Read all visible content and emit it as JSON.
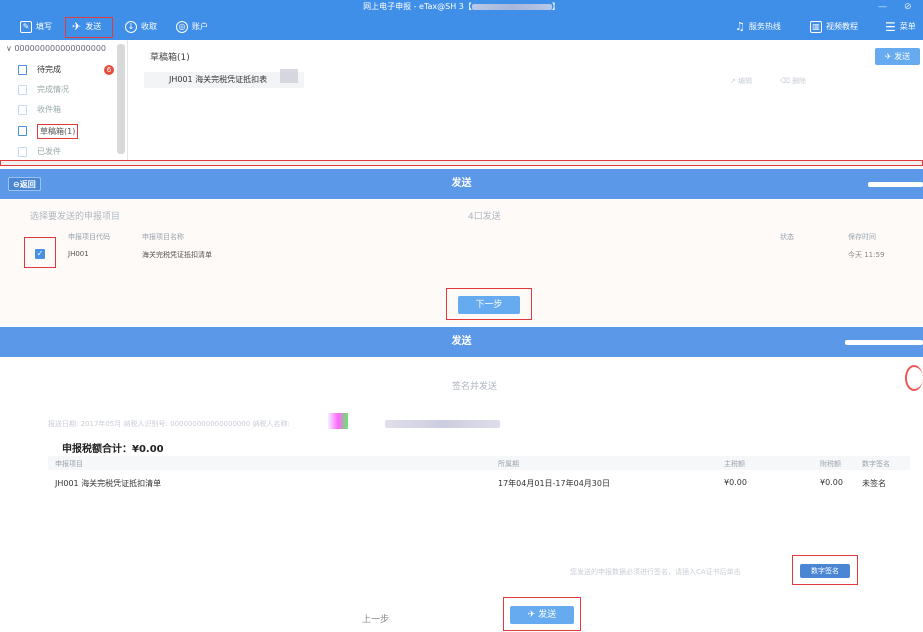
{
  "window": {
    "title": "网上电子申报 - eTax@SH 3【",
    "title_suffix": "】",
    "controls": [
      "—",
      "⊘"
    ]
  },
  "toolbar": {
    "items": [
      {
        "label": "填写",
        "icon": "edit-icon"
      },
      {
        "label": "发送",
        "icon": "send-icon"
      },
      {
        "label": "收取",
        "icon": "download-icon"
      },
      {
        "label": "账户",
        "icon": "account-icon"
      }
    ],
    "right": [
      {
        "label": "服务热线",
        "icon": "headset-icon"
      },
      {
        "label": "视频教程",
        "icon": "video-icon"
      },
      {
        "label": "菜单",
        "icon": "menu-icon"
      }
    ]
  },
  "sidebar": {
    "header": "∨ 000000000000000000",
    "items": [
      {
        "label": "待完成",
        "badge": "6"
      },
      {
        "label": "完成情况",
        "badge": ""
      },
      {
        "label": "收件箱",
        "badge": ""
      },
      {
        "label": "草稿箱(1)",
        "badge": ""
      },
      {
        "label": "已发件",
        "badge": ""
      }
    ]
  },
  "draftbox": {
    "title": "草稿箱(1)",
    "send_button": "发送",
    "row_text": "JH001  海关完税凭证抵扣表",
    "row_actions": [
      "编辑",
      "删除"
    ]
  },
  "send_step1": {
    "back_label": "返回",
    "title": "发送",
    "prompt": "选择要发送的申报项目",
    "count_text": "4口发送",
    "columns": [
      "申报项目代码",
      "申报项目名称",
      "状态",
      "保存时间"
    ],
    "row": {
      "code": "JH001",
      "name": "海关完税凭证抵扣清单",
      "time": "今天 11:59"
    },
    "next_button": "下一步"
  },
  "send_step2": {
    "title": "发送",
    "subtitle": "签名并发送",
    "info_line": "报送日期: 2017年05月    纳税人识别号: 000000000000000000    纳税人名称:",
    "total_label": "申报税额合计：",
    "total_value": "¥0.00",
    "columns": [
      "申报项目",
      "所属期",
      "主税额",
      "附税额",
      "数字签名"
    ],
    "rows": [
      {
        "item": "JH001 海关完税凭证抵扣清单",
        "period": "17年04月01日-17年04月30日",
        "main_tax": "¥0.00",
        "extra_tax": "¥0.00",
        "sign": "未签名"
      }
    ],
    "note": "您发送的申报数据必须进行签名，请插入CA证书后单击",
    "sign_button": "数字签名",
    "prev_label": "上一步",
    "send_button": "发送"
  },
  "colors": {
    "accent": "#3f8ee8",
    "bar": "#5b98e8",
    "highlight": "#e23a3a",
    "button": "#66aaf0"
  }
}
